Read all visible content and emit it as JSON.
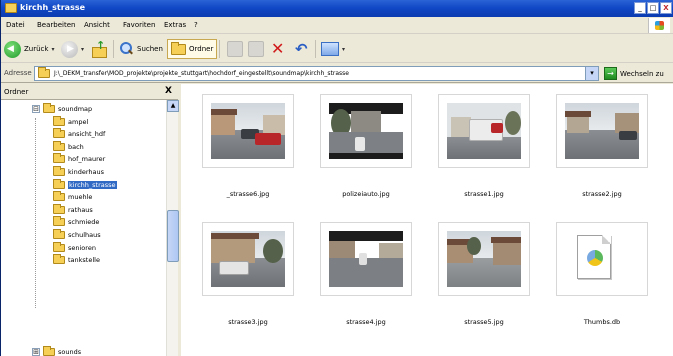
{
  "window": {
    "title": "kirchh_strasse",
    "buttons": [
      "_",
      "□",
      "X"
    ]
  },
  "menubar": {
    "items": [
      "Datei",
      "Bearbeiten",
      "Ansicht",
      "Favoriten",
      "Extras",
      "?"
    ]
  },
  "toolbar": {
    "back_label": "Zurück",
    "search_label": "Suchen",
    "folders_label": "Ordner"
  },
  "addressbar": {
    "label": "Adresse",
    "path": "J:\\_DEKM_transfer\\MOD_projekte\\projekte_stuttgart\\hochdorf_eingestellt\\soundmap\\kirchh_strasse",
    "go_label": "Wechseln zu"
  },
  "sidebar": {
    "title": "Ordner",
    "close": "X",
    "tree": [
      {
        "label": "soundmap",
        "expander": "⊟"
      },
      {
        "label": "ampel"
      },
      {
        "label": "ansicht_hdf"
      },
      {
        "label": "bach"
      },
      {
        "label": "hof_maurer"
      },
      {
        "label": "kinderhaus"
      },
      {
        "label": "kirchh_strasse",
        "selected": true
      },
      {
        "label": "muehle"
      },
      {
        "label": "rathaus"
      },
      {
        "label": "schmiede"
      },
      {
        "label": "schulhaus"
      },
      {
        "label": "senioren"
      },
      {
        "label": "tankstelle"
      },
      {
        "label": "sounds",
        "expander": "⊞"
      }
    ]
  },
  "files": [
    {
      "name": "_strasse6.jpg",
      "kind": "photo",
      "scene": "houses-cars"
    },
    {
      "name": "polizeiauto.jpg",
      "kind": "photo",
      "scene": "dark-street"
    },
    {
      "name": "strasse1.jpg",
      "kind": "photo",
      "scene": "truck"
    },
    {
      "name": "strasse2.jpg",
      "kind": "photo",
      "scene": "street-car"
    },
    {
      "name": "strasse3.jpg",
      "kind": "photo",
      "scene": "van-house"
    },
    {
      "name": "strasse4.jpg",
      "kind": "photo",
      "scene": "dark-road"
    },
    {
      "name": "strasse5.jpg",
      "kind": "photo",
      "scene": "village-road"
    },
    {
      "name": "Thumbs.db",
      "kind": "file",
      "scene": "db-icon"
    }
  ],
  "colors": {
    "titlebar": "#0b3bb0",
    "selection": "#316ac5",
    "chrome": "#ece9d8"
  }
}
